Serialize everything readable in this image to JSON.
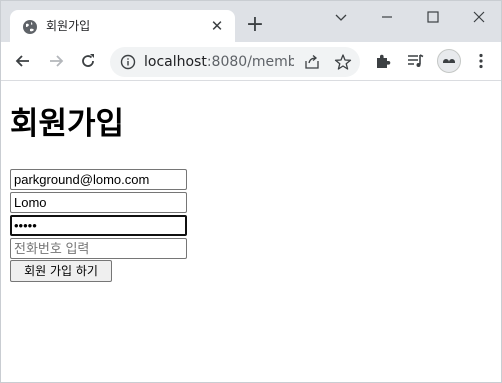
{
  "browser": {
    "tab_title": "회원가입",
    "new_tab_label": "+",
    "url_host": "localhost",
    "url_rest": ":8080/memb..."
  },
  "page": {
    "heading": "회원가입",
    "email_value": "parkground@lomo.com",
    "name_value": "Lomo",
    "password_value": "•••••",
    "phone_placeholder": "전화번호 입력",
    "submit_label": "회원 가입 하기"
  },
  "icons": {
    "favicon": "globe-icon",
    "close": "close-icon",
    "back": "arrow-left-icon",
    "forward": "arrow-right-icon",
    "reload": "reload-icon",
    "info": "info-icon",
    "share": "share-icon",
    "bookmark": "star-icon",
    "extensions": "puzzle-icon",
    "reading_list": "reading-list-icon",
    "profile": "avatar-icon",
    "menu": "kebab-menu-icon"
  }
}
